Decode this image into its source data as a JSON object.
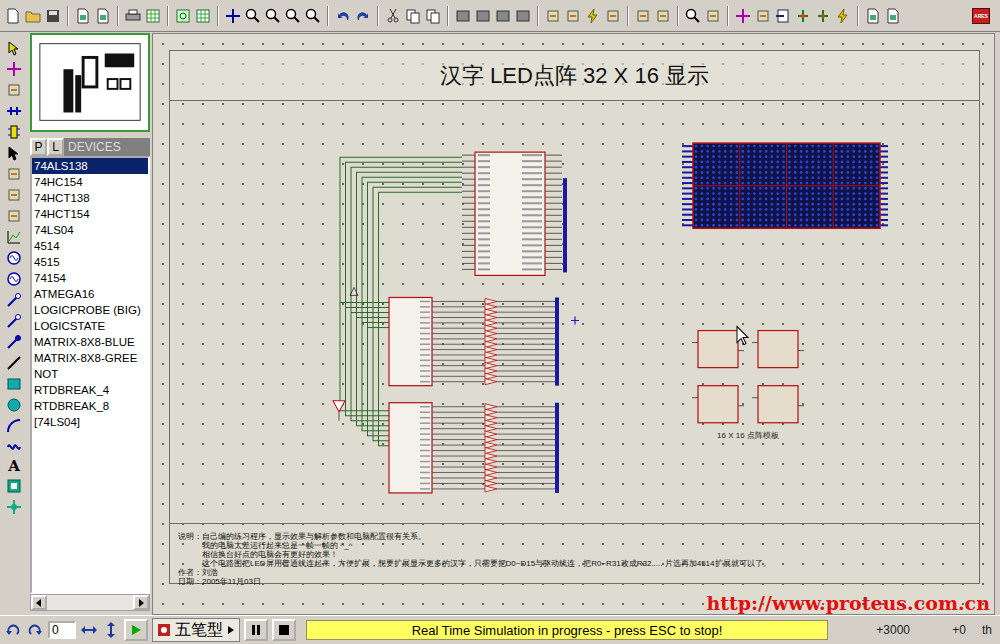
{
  "sheet": {
    "title": "汉字 LED点阵 32 X 16 显示",
    "template_label": "16 X 16 点阵模板",
    "notes": {
      "label": "说明：",
      "lines": [
        "自己编的练习程序，显示效果与解析参数和电脑配置很有关系。",
        "我的电脑太差运行起来总是一帧一帧的          ^_^",
        "相信换台好点的电脑会有更好的效果！",
        "这个电路图把LED屏用普通线连起来，方便扩展，想要扩展显示更多的汉字，只需要把D0~D15与驱动线连，把R0~R31改成R32.....  片选再加4514扩展就可以了。"
      ],
      "author": "作者：刘浩",
      "date": "日期：2005年11月03日"
    }
  },
  "left_toolbar": {
    "text_tool": "A"
  },
  "toolbar": {
    "ares_label": "ARES"
  },
  "picker": {
    "buttons": [
      {
        "label": "P",
        "selected": false
      },
      {
        "label": "L",
        "selected": false
      }
    ],
    "title": "DEVICES"
  },
  "devices": [
    {
      "label": "74ALS138",
      "selected": true
    },
    {
      "label": "74HC154",
      "selected": false
    },
    {
      "label": "74HCT138",
      "selected": false
    },
    {
      "label": "74HCT154",
      "selected": false
    },
    {
      "label": "74LS04",
      "selected": false
    },
    {
      "label": "4514",
      "selected": false
    },
    {
      "label": "4515",
      "selected": false
    },
    {
      "label": "74154",
      "selected": false
    },
    {
      "label": "ATMEGA16",
      "selected": false
    },
    {
      "label": "LOGICPROBE (BIG)",
      "selected": false
    },
    {
      "label": "LOGICSTATE",
      "selected": false
    },
    {
      "label": "MATRIX-8X8-BLUE",
      "selected": false
    },
    {
      "label": "MATRIX-8X8-GREE",
      "selected": false
    },
    {
      "label": "NOT",
      "selected": false
    },
    {
      "label": "RTDBREAK_4",
      "selected": false
    },
    {
      "label": "RTDBREAK_8",
      "selected": false
    },
    {
      "label": "[74LS04]",
      "selected": false
    }
  ],
  "status_bar": {
    "rotation": "0",
    "ime": "五笔型",
    "message": "Real Time Simulation in progress - press ESC to stop!",
    "x": "+3000",
    "y": "+0",
    "unit": "th"
  },
  "watermark": "http://www.proteus.com.cn"
}
